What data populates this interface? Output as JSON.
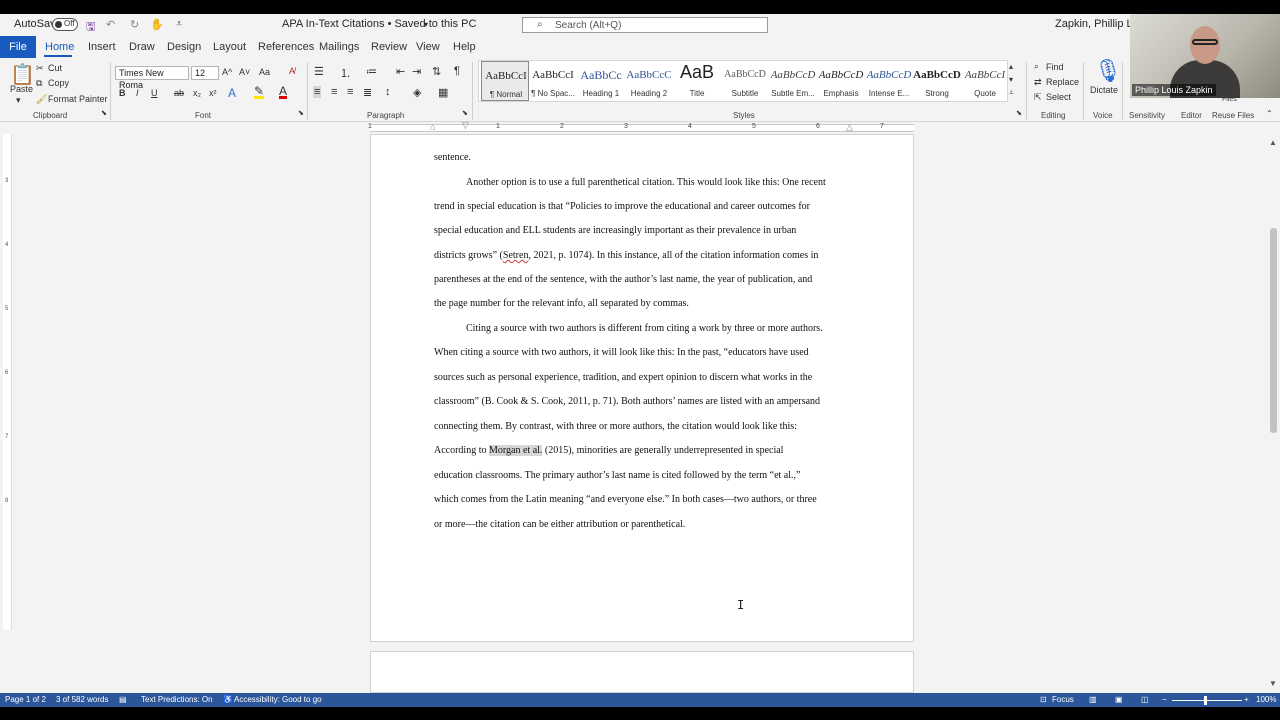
{
  "app": {
    "autosave_label": "AutoSave",
    "autosave_state": "Off",
    "doc_title": "APA In-Text Citations • Saved to this PC",
    "search_placeholder": "Search (Alt+Q)",
    "user_name": "Zapkin, Phillip Louis",
    "accent": "#185abd",
    "status_color": "#2b579a"
  },
  "tabs": [
    "File",
    "Home",
    "Insert",
    "Draw",
    "Design",
    "Layout",
    "References",
    "Mailings",
    "Review",
    "View",
    "Help"
  ],
  "ribbon": {
    "clipboard": {
      "paste": "Paste",
      "cut": "Cut",
      "copy": "Copy",
      "format_painter": "Format Painter",
      "label": "Clipboard"
    },
    "font": {
      "family": "Times New Roma",
      "size": "12",
      "label": "Font",
      "bold": "B",
      "italic": "I",
      "underline": "U",
      "strike": "ab",
      "sub": "x₂",
      "sup": "x²",
      "grow": "A^",
      "shrink": "A˅",
      "case": "Aa"
    },
    "paragraph": {
      "label": "Paragraph",
      "pilcrow": "¶"
    },
    "styles": {
      "label": "Styles",
      "items": [
        {
          "sample": "AaBbCcI",
          "name": "¶ Normal"
        },
        {
          "sample": "AaBbCcI",
          "name": "¶ No Spac..."
        },
        {
          "sample": "AaBbCc",
          "name": "Heading 1"
        },
        {
          "sample": "AaBbCcC",
          "name": "Heading 2"
        },
        {
          "sample": "AaB",
          "name": "Title"
        },
        {
          "sample": "AaBbCcD",
          "name": "Subtitle"
        },
        {
          "sample": "AaBbCcD",
          "name": "Subtle Em..."
        },
        {
          "sample": "AaBbCcD",
          "name": "Emphasis"
        },
        {
          "sample": "AaBbCcD",
          "name": "Intense E..."
        },
        {
          "sample": "AaBbCcD",
          "name": "Strong"
        },
        {
          "sample": "AaBbCcI",
          "name": "Quote"
        }
      ]
    },
    "editing": {
      "find": "Find",
      "replace": "Replace",
      "select": "Select",
      "label": "Editing"
    },
    "voice": {
      "dictate": "Dictate",
      "label": "Voice"
    },
    "sensitivity": "Sensitivity",
    "editor": "Editor",
    "reuse_files": "Reuse Files",
    "files": "Files"
  },
  "webcam": {
    "name": "Phillip Louis Zapkin"
  },
  "ruler": [
    "1",
    "1",
    "2",
    "3",
    "4",
    "5",
    "6",
    "7"
  ],
  "vruler": [
    "3",
    "4",
    "5",
    "6",
    "7",
    "8"
  ],
  "document": {
    "lines": [
      "sentence.",
      "Another option is to use a full parenthetical citation. This would look like this: One recent",
      "trend in special education is that “Policies to improve the educational and career outcomes for",
      "special education and ELL students are increasingly important as their prevalence in urban",
      {
        "a": "districts grows” (",
        "spell": "Setren",
        "b": ", 2021, p. 1074). In this instance, all of the citation information comes in"
      },
      "parentheses at the end of the sentence, with the author’s last name, the year of publication, and",
      "the page number for the relevant info, all separated by commas.",
      "Citing a source with two authors is different from citing a work by three or more authors.",
      "When citing a source with two authors, it will look like this: In the past, “educators have used",
      "sources such as personal experience, tradition, and expert opinion to discern what works in the",
      "classroom” (B. Cook & S. Cook, 2011, p. 71). Both authors’ names are listed with an ampersand",
      "connecting them. By contrast, with three or more authors, the citation would look like this:",
      {
        "a": "According to ",
        "hl": "Morgan et al.",
        "b": " (2015), minorities are generally underrepresented in special"
      },
      "education classrooms. The primary author’s last name is cited followed by the term “et al.,”",
      "which comes from the Latin meaning “and everyone else.” In both cases—two authors, or three",
      "or more—the citation can be either attribution or parenthetical."
    ]
  },
  "status": {
    "page": "Page 1 of 2",
    "words": "3 of 582 words",
    "predictions": "Text Predictions: On",
    "accessibility": "Accessibility: Good to go",
    "focus": "Focus",
    "zoom": "100%"
  }
}
